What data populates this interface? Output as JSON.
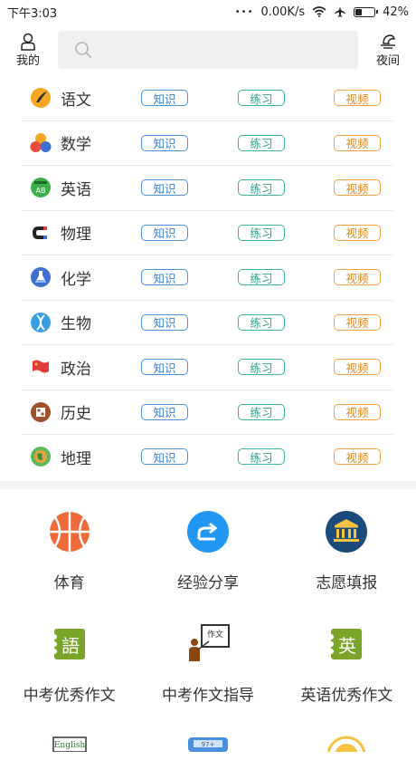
{
  "status_bar": {
    "time": "下午3:03",
    "dots": "•••",
    "speed": "0.00K/s",
    "battery": "42%",
    "battery_level": 42
  },
  "header": {
    "profile_label": "我的",
    "night_label": "夜间",
    "search_placeholder": ""
  },
  "subjects": [
    {
      "name": "语文",
      "icon": "chinese-brush-icon",
      "color": "#f5a623"
    },
    {
      "name": "数学",
      "icon": "math-balls-icon",
      "color": "#e74c3c"
    },
    {
      "name": "英语",
      "icon": "english-ab-icon",
      "color": "#3cae4a"
    },
    {
      "name": "物理",
      "icon": "magnet-icon",
      "color": "#e23b3b"
    },
    {
      "name": "化学",
      "icon": "flask-icon",
      "color": "#3f6fd1"
    },
    {
      "name": "生物",
      "icon": "dna-icon",
      "color": "#3a9fe0"
    },
    {
      "name": "政治",
      "icon": "flag-icon",
      "color": "#e23b3b"
    },
    {
      "name": "历史",
      "icon": "history-book-icon",
      "color": "#a0522d"
    },
    {
      "name": "地理",
      "icon": "globe-icon",
      "color": "#5cb85c"
    }
  ],
  "tags": {
    "knowledge": "知识",
    "practice": "练习",
    "video": "视频"
  },
  "grid": [
    {
      "label": "体育",
      "icon": "basketball-icon"
    },
    {
      "label": "经验分享",
      "icon": "share-icon"
    },
    {
      "label": "志愿填报",
      "icon": "institution-icon"
    },
    {
      "label": "中考优秀作文",
      "icon": "chinese-essay-icon",
      "glyph": "語"
    },
    {
      "label": "中考作文指导",
      "icon": "teacher-board-icon",
      "glyph": "作文"
    },
    {
      "label": "英语优秀作文",
      "icon": "english-essay-icon",
      "glyph": "英"
    }
  ],
  "partial_row": [
    {
      "icon": "english-book-icon",
      "text": "English"
    },
    {
      "icon": "calculator-icon",
      "text": "97+"
    },
    {
      "icon": "sun-icon"
    }
  ]
}
